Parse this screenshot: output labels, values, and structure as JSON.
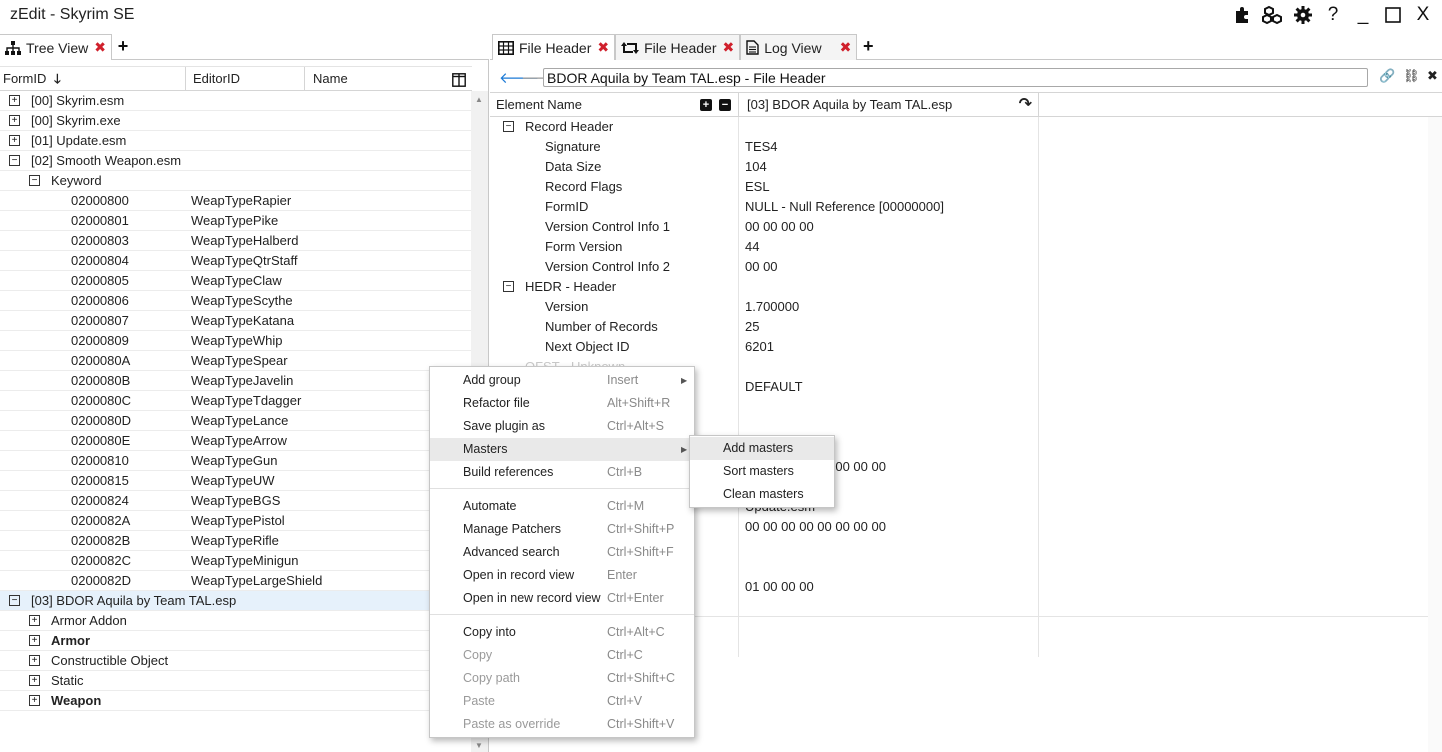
{
  "app": {
    "title": "zEdit - Skyrim SE"
  },
  "titlebar": {
    "help": "?",
    "minimize": "_",
    "maximize": "☐",
    "close": "X"
  },
  "left_tabs": [
    {
      "label": "Tree View"
    }
  ],
  "right_tabs": [
    {
      "label": "File Header"
    },
    {
      "label": "File Header"
    },
    {
      "label": "Log View"
    }
  ],
  "tree_columns": {
    "formid": "FormID",
    "editorid": "EditorID",
    "name": "Name"
  },
  "tree": {
    "files": [
      {
        "label": "[00] Skyrim.esm"
      },
      {
        "label": "[00] Skyrim.exe"
      },
      {
        "label": "[01] Update.esm"
      },
      {
        "label": "[02] Smooth Weapon.esm"
      }
    ],
    "group": "Keyword",
    "records": [
      {
        "formid": "02000800",
        "edid": "WeapTypeRapier"
      },
      {
        "formid": "02000801",
        "edid": "WeapTypePike"
      },
      {
        "formid": "02000803",
        "edid": "WeapTypeHalberd"
      },
      {
        "formid": "02000804",
        "edid": "WeapTypeQtrStaff"
      },
      {
        "formid": "02000805",
        "edid": "WeapTypeClaw"
      },
      {
        "formid": "02000806",
        "edid": "WeapTypeScythe"
      },
      {
        "formid": "02000807",
        "edid": "WeapTypeKatana"
      },
      {
        "formid": "02000809",
        "edid": "WeapTypeWhip"
      },
      {
        "formid": "0200080A",
        "edid": "WeapTypeSpear"
      },
      {
        "formid": "0200080B",
        "edid": "WeapTypeJavelin"
      },
      {
        "formid": "0200080C",
        "edid": "WeapTypeTdagger"
      },
      {
        "formid": "0200080D",
        "edid": "WeapTypeLance"
      },
      {
        "formid": "0200080E",
        "edid": "WeapTypeArrow"
      },
      {
        "formid": "02000810",
        "edid": "WeapTypeGun"
      },
      {
        "formid": "02000815",
        "edid": "WeapTypeUW"
      },
      {
        "formid": "02000824",
        "edid": "WeapTypeBGS"
      },
      {
        "formid": "0200082A",
        "edid": "WeapTypePistol"
      },
      {
        "formid": "0200082B",
        "edid": "WeapTypeRifle"
      },
      {
        "formid": "0200082C",
        "edid": "WeapTypeMinigun"
      },
      {
        "formid": "0200082D",
        "edid": "WeapTypeLargeShield"
      }
    ],
    "selected_file": "[03] BDOR Aquila by Team TAL.esp",
    "plugin_groups": [
      {
        "label": "Armor Addon"
      },
      {
        "label": "Armor"
      },
      {
        "label": "Constructible Object"
      },
      {
        "label": "Static"
      },
      {
        "label": "Weapon"
      }
    ]
  },
  "address": {
    "value": "BDOR Aquila by Team TAL.esp - File Header"
  },
  "record_view": {
    "col_element": "Element Name",
    "col_file": "[03] BDOR Aquila by Team TAL.esp",
    "rows": [
      {
        "name": "Record Header",
        "value": ""
      },
      {
        "name": "Signature",
        "value": "TES4"
      },
      {
        "name": "Data Size",
        "value": "104"
      },
      {
        "name": "Record Flags",
        "value": "ESL"
      },
      {
        "name": "FormID",
        "value": "NULL - Null Reference [00000000]"
      },
      {
        "name": "Version Control Info 1",
        "value": "00 00 00 00"
      },
      {
        "name": "Form Version",
        "value": "44"
      },
      {
        "name": "Version Control Info 2",
        "value": "00 00"
      },
      {
        "name": "HEDR - Header",
        "value": ""
      },
      {
        "name": "Version",
        "value": "1.700000"
      },
      {
        "name": "Number of Records",
        "value": "25"
      },
      {
        "name": "Next Object ID",
        "value": "6201"
      },
      {
        "name": "OFST - Unknown",
        "value": ""
      },
      {
        "name": "",
        "value": "DEFAULT"
      },
      {
        "name": "",
        "value": ""
      },
      {
        "name": "",
        "value": ""
      },
      {
        "name": "",
        "value": ""
      },
      {
        "name": "",
        "value": "00 00 00 00 00 00 00 00"
      },
      {
        "name": "",
        "value": ""
      },
      {
        "name": "",
        "value": "Update.esm"
      },
      {
        "name": "",
        "value": "00 00 00 00 00 00 00 00"
      },
      {
        "name": "",
        "value": ""
      },
      {
        "name": "",
        "value": ""
      },
      {
        "name": "",
        "value": "01 00 00 00"
      },
      {
        "name": "",
        "value": ""
      }
    ]
  },
  "context_menu": {
    "items": [
      {
        "label": "Add group",
        "shortcut": "Insert"
      },
      {
        "label": "Refactor file",
        "shortcut": "Alt+Shift+R"
      },
      {
        "label": "Save plugin as",
        "shortcut": "Ctrl+Alt+S"
      },
      {
        "label": "Masters",
        "shortcut": ""
      },
      {
        "label": "Build references",
        "shortcut": "Ctrl+B"
      },
      {
        "label": "Automate",
        "shortcut": "Ctrl+M"
      },
      {
        "label": "Manage Patchers",
        "shortcut": "Ctrl+Shift+P"
      },
      {
        "label": "Advanced search",
        "shortcut": "Ctrl+Shift+F"
      },
      {
        "label": "Open in record view",
        "shortcut": "Enter"
      },
      {
        "label": "Open in new record view",
        "shortcut": "Ctrl+Enter"
      },
      {
        "label": "Copy into",
        "shortcut": "Ctrl+Alt+C"
      },
      {
        "label": "Copy",
        "shortcut": "Ctrl+C"
      },
      {
        "label": "Copy path",
        "shortcut": "Ctrl+Shift+C"
      },
      {
        "label": "Paste",
        "shortcut": "Ctrl+V"
      },
      {
        "label": "Paste as override",
        "shortcut": "Ctrl+Shift+V"
      }
    ],
    "submenu": [
      {
        "label": "Add masters"
      },
      {
        "label": "Sort masters"
      },
      {
        "label": "Clean masters"
      }
    ]
  },
  "colors": {
    "accent": "#1c7ad6",
    "close_x": "#d0202c",
    "selection": "#e6f1fb"
  }
}
